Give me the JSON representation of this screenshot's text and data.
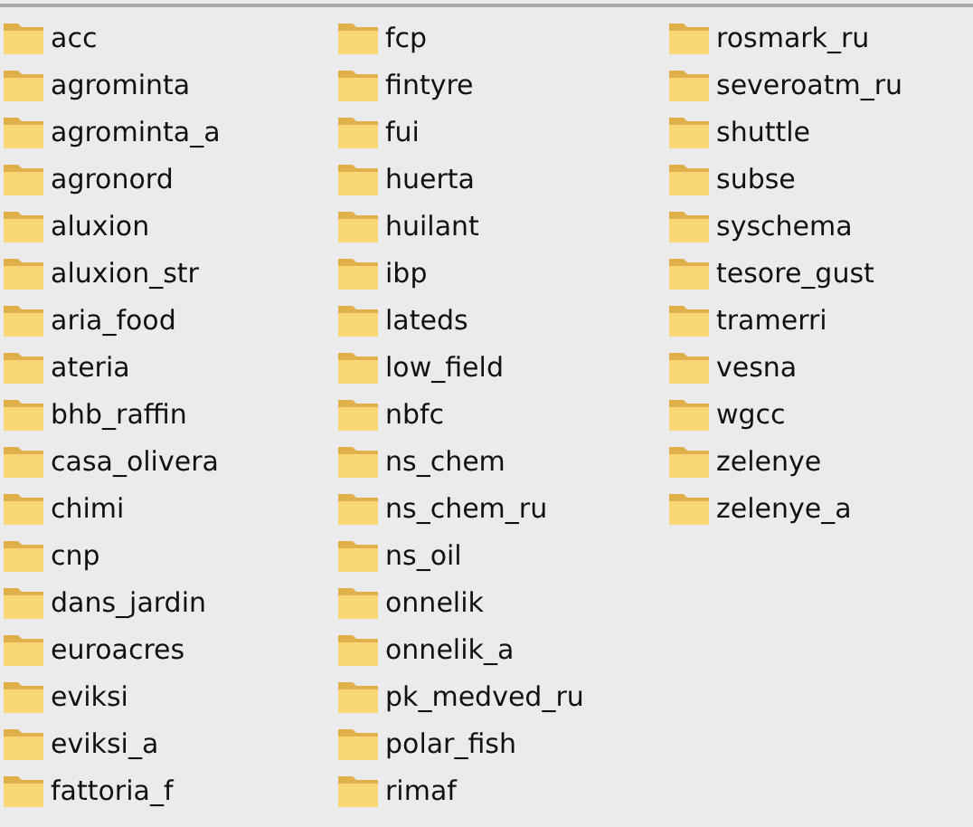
{
  "columns": [
    {
      "items": [
        "acc",
        "agrominta",
        "agrominta_a",
        "agronord",
        "aluxion",
        "aluxion_str",
        "aria_food",
        "ateria",
        "bhb_raffin",
        "casa_olivera",
        "chimi",
        "cnp",
        "dans_jardin",
        "euroacres",
        "eviksi",
        "eviksi_a",
        "fattoria_f"
      ]
    },
    {
      "items": [
        "fcp",
        "fintyre",
        "fui",
        "huerta",
        "huilant",
        "ibp",
        "lateds",
        "low_field",
        "nbfc",
        "ns_chem",
        "ns_chem_ru",
        "ns_oil",
        "onnelik",
        "onnelik_a",
        "pk_medved_ru",
        "polar_fish",
        "rimaf"
      ]
    },
    {
      "items": [
        "rosmark_ru",
        "severoatm_ru",
        "shuttle",
        "subse",
        "syschema",
        "tesore_gust",
        "tramerri",
        "vesna",
        "wgcc",
        "zelenye",
        "zelenye_a"
      ]
    }
  ]
}
